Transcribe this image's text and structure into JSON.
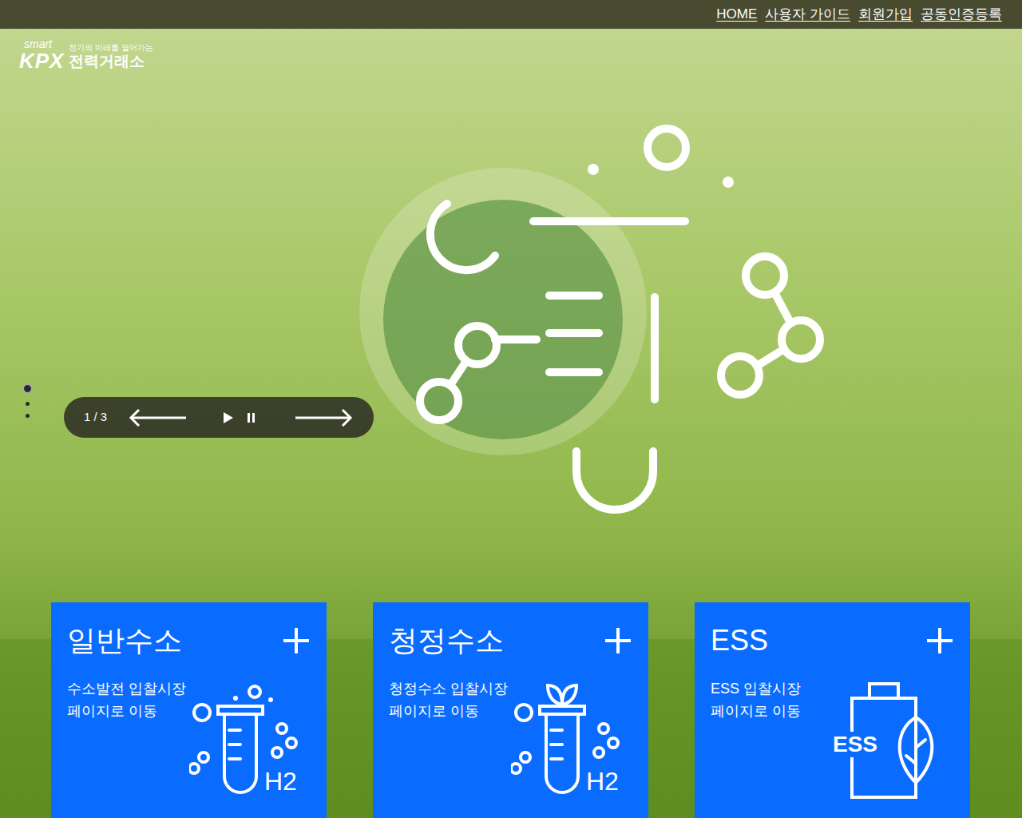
{
  "top_nav": {
    "links": [
      "HOME",
      "사용자 가이드",
      "회원가입",
      "공동인증등록"
    ]
  },
  "logo": {
    "brand": "smart",
    "mark": "KPX",
    "tagline": "전기의 미래를 열어가는",
    "name": "전력거래소"
  },
  "slider": {
    "counter": "1 / 3",
    "dots": [
      {
        "selected": true
      },
      {
        "selected": false
      },
      {
        "selected": false
      }
    ]
  },
  "cards": [
    {
      "title": "일반수소",
      "lines": [
        "수소발전 입찰시장",
        "페이지로 이동"
      ],
      "kind": "tube",
      "icon_text": "H2"
    },
    {
      "title": "청정수소",
      "lines": [
        "청정수소 입찰시장",
        "페이지로 이동"
      ],
      "kind": "sprout",
      "icon_text": "H2"
    },
    {
      "title": "ESS",
      "lines": [
        "ESS 입찰시장",
        "페이지로 이동"
      ],
      "kind": "battery",
      "icon_text": "ESS"
    }
  ]
}
